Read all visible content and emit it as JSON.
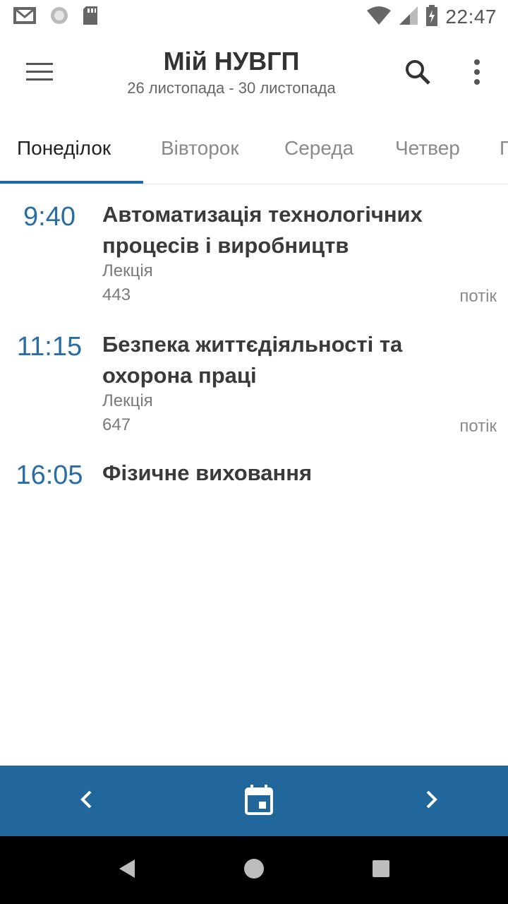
{
  "status_bar": {
    "time": "22:47",
    "icons": [
      "gmail-icon",
      "sync-icon",
      "sd-card-icon",
      "wifi-icon",
      "signal-icon",
      "battery-charging-icon"
    ]
  },
  "app_bar": {
    "title": "Мій НУВГП",
    "subtitle": "26 листопада - 30 листопада",
    "icons": [
      "menu-icon",
      "search-icon",
      "more-vert-icon"
    ]
  },
  "tabs": [
    {
      "label": "Понеділок",
      "active": true
    },
    {
      "label": "Вівторок",
      "active": false
    },
    {
      "label": "Середа",
      "active": false
    },
    {
      "label": "Четвер",
      "active": false
    },
    {
      "label": "П",
      "active": false
    }
  ],
  "lessons": [
    {
      "time": "9:40",
      "title": "Автоматизація технологічних процесів і виробництв",
      "type": "Лекція",
      "room": "443",
      "group": "потік"
    },
    {
      "time": "11:15",
      "title": "Безпека життєдіяльності та охорона праці",
      "type": "Лекція",
      "room": "647",
      "group": "потік"
    },
    {
      "time": "16:05",
      "title": "Фізичне виховання",
      "type": "",
      "room": "",
      "group": ""
    }
  ],
  "bottom_bar": {
    "icons": [
      "chevron-left-icon",
      "calendar-today-icon",
      "chevron-right-icon"
    ]
  },
  "colors": {
    "accent": "#21679c",
    "time_text": "#2a6da3"
  }
}
